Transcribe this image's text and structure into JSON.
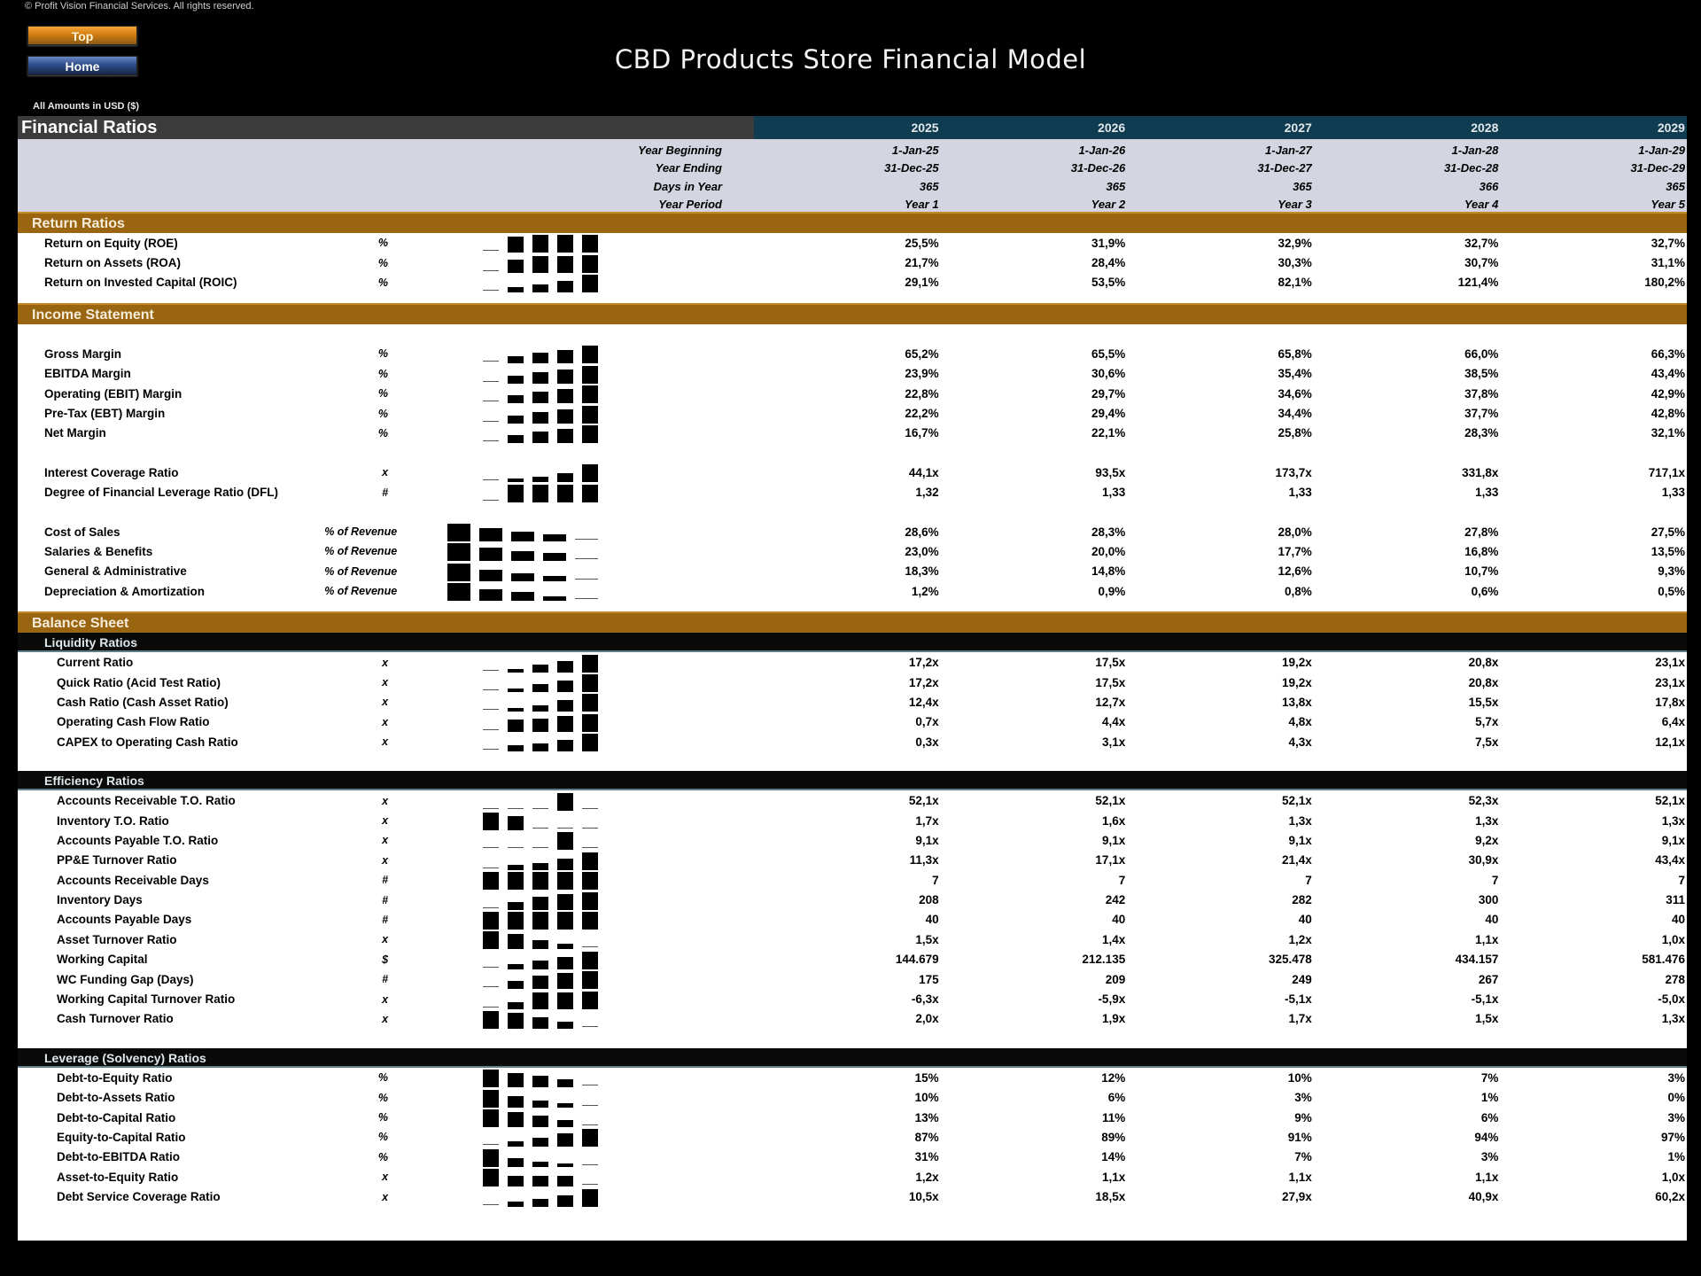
{
  "header": {
    "copyright": "© Profit Vision Financial Services. All rights reserved.",
    "top_button": "Top",
    "home_button": "Home",
    "title": "CBD Products Store Financial Model",
    "amounts_note": "All Amounts in  USD ($)"
  },
  "table": {
    "title": "Financial Ratios",
    "years": [
      "2025",
      "2026",
      "2027",
      "2028",
      "2029"
    ],
    "info_rows": [
      {
        "label": "Year Beginning",
        "values": [
          "1-Jan-25",
          "1-Jan-26",
          "1-Jan-27",
          "1-Jan-28",
          "1-Jan-29"
        ]
      },
      {
        "label": "Year Ending",
        "values": [
          "31-Dec-25",
          "31-Dec-26",
          "31-Dec-27",
          "31-Dec-28",
          "31-Dec-29"
        ]
      },
      {
        "label": "Days in Year",
        "values": [
          "365",
          "365",
          "365",
          "366",
          "365"
        ]
      },
      {
        "label": "Year Period",
        "values": [
          "Year 1",
          "Year 2",
          "Year 3",
          "Year 4",
          "Year 5"
        ]
      }
    ]
  },
  "sections": {
    "return_ratios": {
      "title": "Return Ratios",
      "rows": [
        {
          "label": "Return on Equity (ROE)",
          "unit": "%",
          "values": [
            "25,5%",
            "31,9%",
            "32,9%",
            "32,7%",
            "32,7%"
          ],
          "spark": [
            25.5,
            31.9,
            32.9,
            32.7,
            32.7
          ]
        },
        {
          "label": "Return on Assets (ROA)",
          "unit": "%",
          "values": [
            "21,7%",
            "28,4%",
            "30,3%",
            "30,7%",
            "31,1%"
          ],
          "spark": [
            21.7,
            28.4,
            30.3,
            30.7,
            31.1
          ]
        },
        {
          "label": "Return on Invested Capital (ROIC)",
          "unit": "%",
          "values": [
            "29,1%",
            "53,5%",
            "82,1%",
            "121,4%",
            "180,2%"
          ],
          "spark": [
            29.1,
            53.5,
            82.1,
            121.4,
            180.2
          ]
        }
      ]
    },
    "income_statement": {
      "title": "Income Statement",
      "margins": [
        {
          "label": "Gross Margin",
          "unit": "%",
          "values": [
            "65,2%",
            "65,5%",
            "65,8%",
            "66,0%",
            "66,3%"
          ],
          "spark": [
            65.2,
            65.5,
            65.8,
            66.0,
            66.3
          ]
        },
        {
          "label": "EBITDA Margin",
          "unit": "%",
          "values": [
            "23,9%",
            "30,6%",
            "35,4%",
            "38,5%",
            "43,4%"
          ],
          "spark": [
            23.9,
            30.6,
            35.4,
            38.5,
            43.4
          ]
        },
        {
          "label": "Operating (EBIT) Margin",
          "unit": "%",
          "values": [
            "22,8%",
            "29,7%",
            "34,6%",
            "37,8%",
            "42,9%"
          ],
          "spark": [
            22.8,
            29.7,
            34.6,
            37.8,
            42.9
          ]
        },
        {
          "label": "Pre-Tax (EBT) Margin",
          "unit": "%",
          "values": [
            "22,2%",
            "29,4%",
            "34,4%",
            "37,7%",
            "42,8%"
          ],
          "spark": [
            22.2,
            29.4,
            34.4,
            37.7,
            42.8
          ]
        },
        {
          "label": "Net Margin",
          "unit": "%",
          "values": [
            "16,7%",
            "22,1%",
            "25,8%",
            "28,3%",
            "32,1%"
          ],
          "spark": [
            16.7,
            22.1,
            25.8,
            28.3,
            32.1
          ]
        }
      ],
      "coverage": [
        {
          "label": "Interest Coverage Ratio",
          "unit": "x",
          "values": [
            "44,1x",
            "93,5x",
            "173,7x",
            "331,8x",
            "717,1x"
          ],
          "spark": [
            44.1,
            93.5,
            173.7,
            331.8,
            717.1
          ]
        },
        {
          "label": "Degree of Financial Leverage Ratio (DFL)",
          "unit": "#",
          "values": [
            "1,32",
            "1,33",
            "1,33",
            "1,33",
            "1,33"
          ],
          "spark": [
            1.32,
            1.33,
            1.33,
            1.33,
            1.33
          ]
        }
      ],
      "costs": [
        {
          "label": "Cost of Sales",
          "unit": "% of Revenue",
          "values": [
            "28,6%",
            "28,3%",
            "28,0%",
            "27,8%",
            "27,5%"
          ],
          "spark": [
            28.6,
            28.3,
            28.0,
            27.8,
            27.5
          ]
        },
        {
          "label": "Salaries & Benefits",
          "unit": "% of Revenue",
          "values": [
            "23,0%",
            "20,0%",
            "17,7%",
            "16,8%",
            "13,5%"
          ],
          "spark": [
            23.0,
            20.0,
            17.7,
            16.8,
            13.5
          ]
        },
        {
          "label": "General & Administrative",
          "unit": "% of Revenue",
          "values": [
            "18,3%",
            "14,8%",
            "12,6%",
            "10,7%",
            "9,3%"
          ],
          "spark": [
            18.3,
            14.8,
            12.6,
            10.7,
            9.3
          ]
        },
        {
          "label": "Depreciation & Amortization",
          "unit": "% of Revenue",
          "values": [
            "1,2%",
            "0,9%",
            "0,8%",
            "0,6%",
            "0,5%"
          ],
          "spark": [
            1.2,
            0.9,
            0.8,
            0.6,
            0.5
          ]
        }
      ]
    },
    "balance_sheet": {
      "title": "Balance Sheet",
      "liquidity": {
        "title": "Liquidity Ratios",
        "rows": [
          {
            "label": "Current Ratio",
            "unit": "x",
            "values": [
              "17,2x",
              "17,5x",
              "19,2x",
              "20,8x",
              "23,1x"
            ],
            "spark": [
              17.2,
              17.5,
              19.2,
              20.8,
              23.1
            ]
          },
          {
            "label": "Quick Ratio (Acid Test Ratio)",
            "unit": "x",
            "values": [
              "17,2x",
              "17,5x",
              "19,2x",
              "20,8x",
              "23,1x"
            ],
            "spark": [
              17.2,
              17.5,
              19.2,
              20.8,
              23.1
            ]
          },
          {
            "label": "Cash Ratio (Cash Asset Ratio)",
            "unit": "x",
            "values": [
              "12,4x",
              "12,7x",
              "13,8x",
              "15,5x",
              "17,8x"
            ],
            "spark": [
              12.4,
              12.7,
              13.8,
              15.5,
              17.8
            ]
          },
          {
            "label": "Operating Cash Flow Ratio",
            "unit": "x",
            "values": [
              "0,7x",
              "4,4x",
              "4,8x",
              "5,7x",
              "6,4x"
            ],
            "spark": [
              0.7,
              4.4,
              4.8,
              5.7,
              6.4
            ]
          },
          {
            "label": "CAPEX to Operating Cash Ratio",
            "unit": "x",
            "values": [
              "0,3x",
              "3,1x",
              "4,3x",
              "7,5x",
              "12,1x"
            ],
            "spark": [
              0.3,
              3.1,
              4.3,
              7.5,
              12.1
            ]
          }
        ]
      },
      "efficiency": {
        "title": "Efficiency Ratios",
        "rows": [
          {
            "label": "Accounts Receivable T.O. Ratio",
            "unit": "x",
            "values": [
              "52,1x",
              "52,1x",
              "52,1x",
              "52,3x",
              "52,1x"
            ],
            "spark": [
              52.1,
              52.1,
              52.1,
              52.3,
              52.1
            ]
          },
          {
            "label": "Inventory T.O. Ratio",
            "unit": "x",
            "values": [
              "1,7x",
              "1,6x",
              "1,3x",
              "1,3x",
              "1,3x"
            ],
            "spark": [
              1.7,
              1.6,
              1.3,
              1.3,
              1.3
            ]
          },
          {
            "label": "Accounts Payable T.O. Ratio",
            "unit": "x",
            "values": [
              "9,1x",
              "9,1x",
              "9,1x",
              "9,2x",
              "9,1x"
            ],
            "spark": [
              9.1,
              9.1,
              9.1,
              9.2,
              9.1
            ]
          },
          {
            "label": "PP&E Turnover Ratio",
            "unit": "x",
            "values": [
              "11,3x",
              "17,1x",
              "21,4x",
              "30,9x",
              "43,4x"
            ],
            "spark": [
              11.3,
              17.1,
              21.4,
              30.9,
              43.4
            ]
          },
          {
            "label": "Accounts Receivable Days",
            "unit": "#",
            "values": [
              "7",
              "7",
              "7",
              "7",
              "7"
            ],
            "spark": [
              7,
              7,
              7,
              7,
              7
            ]
          },
          {
            "label": "Inventory Days",
            "unit": "#",
            "values": [
              "208",
              "242",
              "282",
              "300",
              "311"
            ],
            "spark": [
              208,
              242,
              282,
              300,
              311
            ]
          },
          {
            "label": "Accounts Payable Days",
            "unit": "#",
            "values": [
              "40",
              "40",
              "40",
              "40",
              "40"
            ],
            "spark": [
              40,
              40,
              40,
              40,
              40
            ]
          },
          {
            "label": "Asset Turnover Ratio",
            "unit": "x",
            "values": [
              "1,5x",
              "1,4x",
              "1,2x",
              "1,1x",
              "1,0x"
            ],
            "spark": [
              1.5,
              1.4,
              1.2,
              1.1,
              1.0
            ]
          },
          {
            "label": "Working Capital",
            "unit": "$",
            "values": [
              "144.679",
              "212.135",
              "325.478",
              "434.157",
              "581.476"
            ],
            "spark": [
              144679,
              212135,
              325478,
              434157,
              581476
            ]
          },
          {
            "label": "WC Funding Gap (Days)",
            "unit": "#",
            "values": [
              "175",
              "209",
              "249",
              "267",
              "278"
            ],
            "spark": [
              175,
              209,
              249,
              267,
              278
            ]
          },
          {
            "label": "Working Capital Turnover Ratio",
            "unit": "x",
            "values": [
              "-6,3x",
              "-5,9x",
              "-5,1x",
              "-5,1x",
              "-5,0x"
            ],
            "spark": [
              -6.3,
              -5.9,
              -5.1,
              -5.1,
              -5.0
            ]
          },
          {
            "label": "Cash Turnover Ratio",
            "unit": "x",
            "values": [
              "2,0x",
              "1,9x",
              "1,7x",
              "1,5x",
              "1,3x"
            ],
            "spark": [
              2.0,
              1.9,
              1.7,
              1.5,
              1.3
            ]
          }
        ]
      },
      "leverage": {
        "title": "Leverage (Solvency) Ratios",
        "rows": [
          {
            "label": "Debt-to-Equity Ratio",
            "unit": "%",
            "values": [
              "15%",
              "12%",
              "10%",
              "7%",
              "3%"
            ],
            "spark": [
              15,
              12,
              10,
              7,
              3
            ]
          },
          {
            "label": "Debt-to-Assets Ratio",
            "unit": "%",
            "values": [
              "10%",
              "6%",
              "3%",
              "1%",
              "0%"
            ],
            "spark": [
              10,
              6,
              3,
              1,
              0
            ]
          },
          {
            "label": "Debt-to-Capital Ratio",
            "unit": "%",
            "values": [
              "13%",
              "11%",
              "9%",
              "6%",
              "3%"
            ],
            "spark": [
              13,
              11,
              9,
              6,
              3
            ]
          },
          {
            "label": "Equity-to-Capital Ratio",
            "unit": "%",
            "values": [
              "87%",
              "89%",
              "91%",
              "94%",
              "97%"
            ],
            "spark": [
              87,
              89,
              91,
              94,
              97
            ]
          },
          {
            "label": "Debt-to-EBITDA Ratio",
            "unit": "%",
            "values": [
              "31%",
              "14%",
              "7%",
              "3%",
              "1%"
            ],
            "spark": [
              31,
              14,
              7,
              3,
              1
            ]
          },
          {
            "label": "Asset-to-Equity Ratio",
            "unit": "x",
            "values": [
              "1,2x",
              "1,1x",
              "1,1x",
              "1,1x",
              "1,0x"
            ],
            "spark": [
              1.2,
              1.1,
              1.1,
              1.1,
              1.0
            ]
          },
          {
            "label": "Debt Service Coverage Ratio",
            "unit": "x",
            "values": [
              "10,5x",
              "18,5x",
              "27,9x",
              "40,9x",
              "60,2x"
            ],
            "spark": [
              10.5,
              18.5,
              27.9,
              40.9,
              60.2
            ]
          }
        ]
      }
    }
  }
}
